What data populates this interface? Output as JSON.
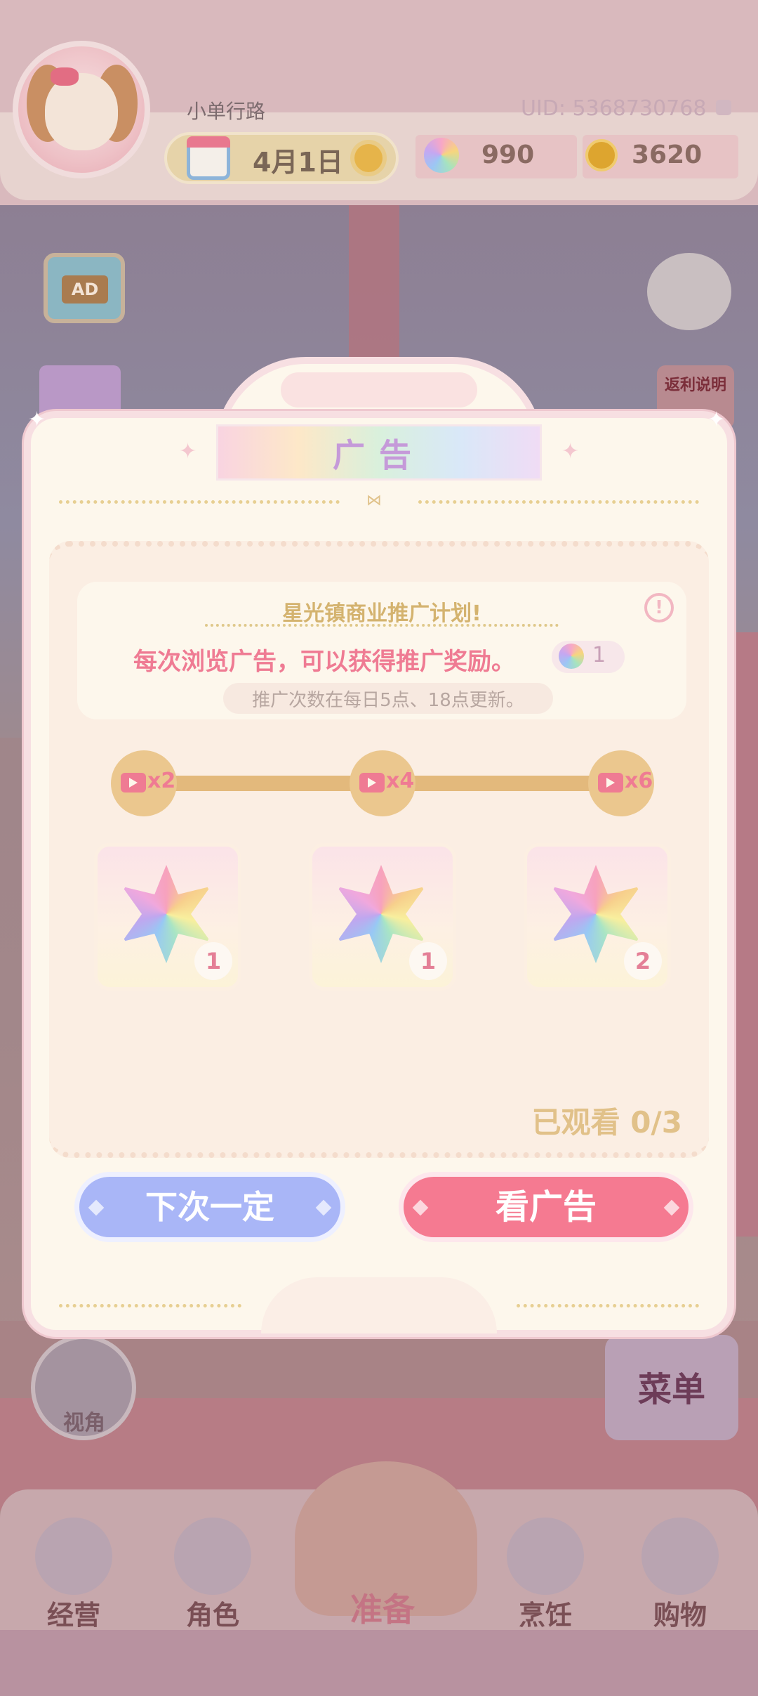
{
  "header": {
    "username": "小单行路",
    "uid": "UID: 5368730768",
    "date": "4月1日",
    "resources": {
      "gems": "990",
      "coins": "3620"
    }
  },
  "side": {
    "ad_label": "AD",
    "rebate_label": "返利说明"
  },
  "modal": {
    "title": "广告",
    "info": {
      "headline": "星光镇商业推广计划!",
      "main": "每次浏览广告，可以获得推广奖励。",
      "reward_value": "1",
      "note": "推广次数在每日5点、18点更新。"
    },
    "milestones": [
      {
        "label": "x2"
      },
      {
        "label": "x4"
      },
      {
        "label": "x6"
      }
    ],
    "rewards": [
      {
        "qty": "1"
      },
      {
        "qty": "1"
      },
      {
        "qty": "2"
      }
    ],
    "watched": "已观看 0/3",
    "btn_later": "下次一定",
    "btn_watch": "看广告"
  },
  "floating": {
    "camera_label": "视角",
    "menu_label": "菜单"
  },
  "nav": {
    "items": [
      {
        "label": "经营"
      },
      {
        "label": "角色"
      },
      {
        "label": "准备"
      },
      {
        "label": "烹饪"
      },
      {
        "label": "购物"
      }
    ]
  },
  "colors": {
    "accent_pink": "#f57a91",
    "accent_blue": "#a9b6f7",
    "gold": "#e1c189"
  }
}
